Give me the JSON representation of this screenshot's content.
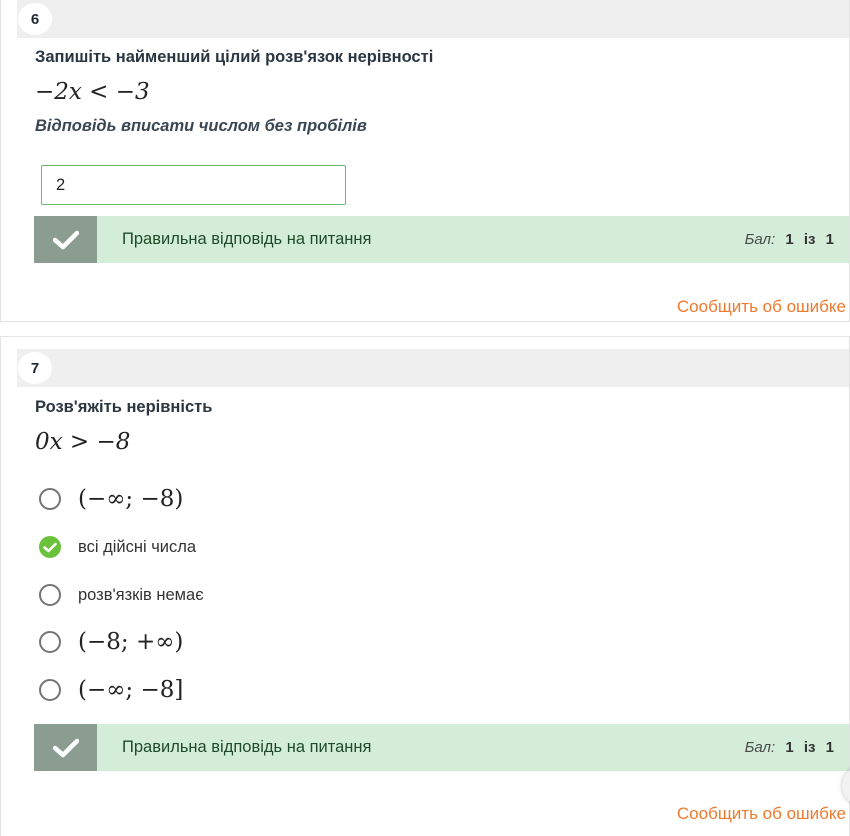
{
  "q6": {
    "number": "6",
    "prompt": "Запишіть найменший цілий розв'язок нерівності",
    "expression": "−2x < −3",
    "hint": "Відповідь вписати числом без пробілів",
    "answer_value": "2",
    "result_message": "Правильна відповідь на питання",
    "score_label": "Бал:",
    "score_value": "1",
    "score_of": "із",
    "score_max": "1",
    "report_link": "Сообщить об ошибке"
  },
  "q7": {
    "number": "7",
    "prompt": "Розв'яжіть нерівність",
    "expression": "0x > −8",
    "options": [
      {
        "label": "(−∞; −8)",
        "selected": false
      },
      {
        "label": "всі дійсні числа",
        "selected": true
      },
      {
        "label": "розв'язків немає",
        "selected": false
      },
      {
        "label": "(−8; +∞)",
        "selected": false
      },
      {
        "label": "(−∞; −8]",
        "selected": false
      }
    ],
    "result_message": "Правильна відповідь на питання",
    "score_label": "Бал:",
    "score_value": "1",
    "score_of": "із",
    "score_max": "1",
    "report_link": "Сообщить об ошибке"
  },
  "colors": {
    "success_bg": "#d4edd9",
    "check_box": "#8b9d91",
    "radio_selected": "#6ac13a",
    "link": "#ee7a2e",
    "input_border": "#6cb86c"
  }
}
